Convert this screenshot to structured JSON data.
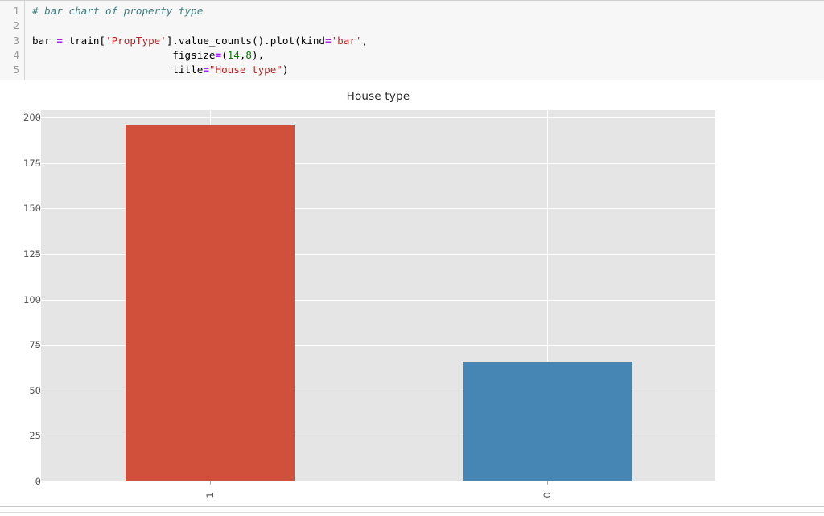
{
  "notebook": {
    "cell": {
      "line_numbers": [
        "1",
        "2",
        "3",
        "4",
        "5"
      ],
      "lines": [
        {
          "segments": [
            {
              "type": "comment",
              "text": "# bar chart of property type"
            }
          ]
        },
        {
          "segments": [
            {
              "type": "plain",
              "text": ""
            }
          ]
        },
        {
          "segments": [
            {
              "type": "plain",
              "text": "bar "
            },
            {
              "type": "op",
              "text": "="
            },
            {
              "type": "plain",
              "text": " train["
            },
            {
              "type": "str",
              "text": "'PropType'"
            },
            {
              "type": "plain",
              "text": "].value_counts().plot(kind"
            },
            {
              "type": "op",
              "text": "="
            },
            {
              "type": "str",
              "text": "'bar'"
            },
            {
              "type": "plain",
              "text": ","
            }
          ]
        },
        {
          "segments": [
            {
              "type": "plain",
              "text": "                       figsize"
            },
            {
              "type": "op",
              "text": "="
            },
            {
              "type": "plain",
              "text": "("
            },
            {
              "type": "num",
              "text": "14"
            },
            {
              "type": "plain",
              "text": ","
            },
            {
              "type": "num",
              "text": "8"
            },
            {
              "type": "plain",
              "text": "),"
            }
          ]
        },
        {
          "segments": [
            {
              "type": "plain",
              "text": "                       title"
            },
            {
              "type": "op",
              "text": "="
            },
            {
              "type": "str",
              "text": "\"House type\""
            },
            {
              "type": "plain",
              "text": ")"
            }
          ]
        }
      ]
    }
  },
  "chart_data": {
    "type": "bar",
    "title": "House type",
    "xlabel": "",
    "ylabel": "",
    "categories": [
      "1",
      "0"
    ],
    "values": [
      196,
      66
    ],
    "bar_colors": [
      "#d1503c",
      "#4686b4"
    ],
    "ylim": [
      0,
      204
    ],
    "yticks": [
      0,
      25,
      50,
      75,
      100,
      125,
      150,
      175,
      200
    ],
    "ytick_labels": [
      "0",
      "25",
      "50",
      "75",
      "100",
      "125",
      "150",
      "175",
      "200"
    ],
    "xtick_labels": [
      "1",
      "0"
    ],
    "xtick_rotation": 90,
    "grid": true,
    "grid_color": "#ffffff",
    "plot_bg": "#e5e5e5",
    "figure_bg": "#ffffff",
    "legend": null,
    "legend_position": "none",
    "figsize": [
      14,
      8
    ]
  },
  "theme": {
    "code_bg": "#f7f7f7",
    "gutter_text": "#9a9a9a",
    "comment_color": "#408080",
    "string_color": "#ba2121",
    "number_color": "#008000",
    "operator_color": "#aa22ff",
    "tick_color": "#555555",
    "title_color": "#262626"
  }
}
